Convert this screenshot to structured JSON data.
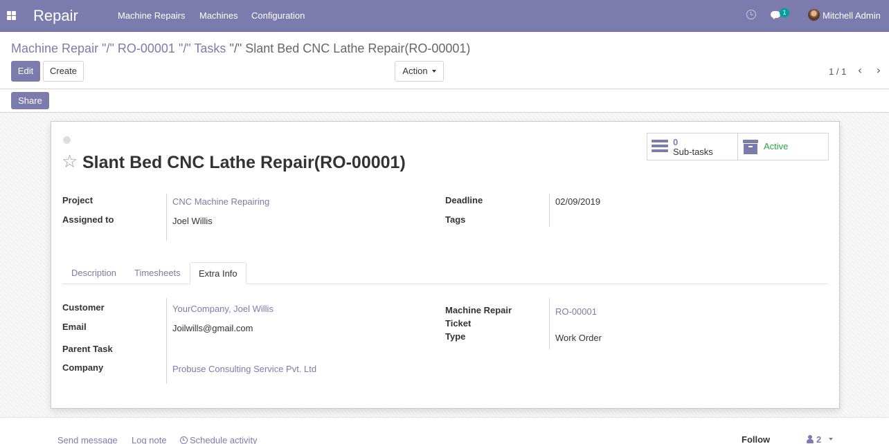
{
  "navbar": {
    "app_name": "Repair",
    "menu": [
      "Machine Repairs",
      "Machines",
      "Configuration"
    ],
    "messages_badge": "1",
    "user_name": "Mitchell Admin",
    "color": "#7c7bad"
  },
  "breadcrumb": {
    "items": [
      "Machine Repair \"/\" RO-00001 \"/\" Tasks \"/\""
    ],
    "link_1": "Machine Repair",
    "sep": "\"/\"",
    "link_2": "RO-00001",
    "link_3": "Tasks",
    "current": "Slant Bed CNC Lathe Repair(RO-00001)"
  },
  "control_panel": {
    "edit_label": "Edit",
    "create_label": "Create",
    "action_label": "Action",
    "share_label": "Share",
    "pager": "1 / 1"
  },
  "task": {
    "title": "Slant Bed CNC Lathe Repair(RO-00001)",
    "subtasks_count": "0",
    "subtasks_label": "Sub-tasks",
    "status_label": "Active",
    "fields": {
      "project_label": "Project",
      "project_value": "CNC Machine Repairing",
      "assigned_label": "Assigned to",
      "assigned_value": "Joel Willis",
      "deadline_label": "Deadline",
      "deadline_value": "02/09/2019",
      "tags_label": "Tags"
    },
    "tabs": [
      "Description",
      "Timesheets",
      "Extra Info"
    ],
    "active_tab": "Extra Info",
    "extra_info": {
      "customer_label": "Customer",
      "customer_value": "YourCompany, Joel Willis",
      "email_label": "Email",
      "email_value": "Joilwills@gmail.com",
      "parent_task_label": "Parent Task",
      "company_label": "Company",
      "company_value": "Probuse Consulting Service Pvt. Ltd",
      "ticket_label_line1": "Machine Repair",
      "ticket_label_line2": "Ticket",
      "ticket_value": "RO-00001",
      "type_label": "Type",
      "type_value": "Work Order"
    }
  },
  "chatter": {
    "send_message": "Send message",
    "log_note": "Log note",
    "schedule_activity": "Schedule activity",
    "follow": "Follow",
    "followers_count": "2"
  },
  "icons": [
    "apps-icon",
    "clock-icon",
    "chat-icon",
    "star-icon",
    "subtasks-icon",
    "archive-icon",
    "chevron-left-icon",
    "chevron-right-icon",
    "user-icon"
  ]
}
